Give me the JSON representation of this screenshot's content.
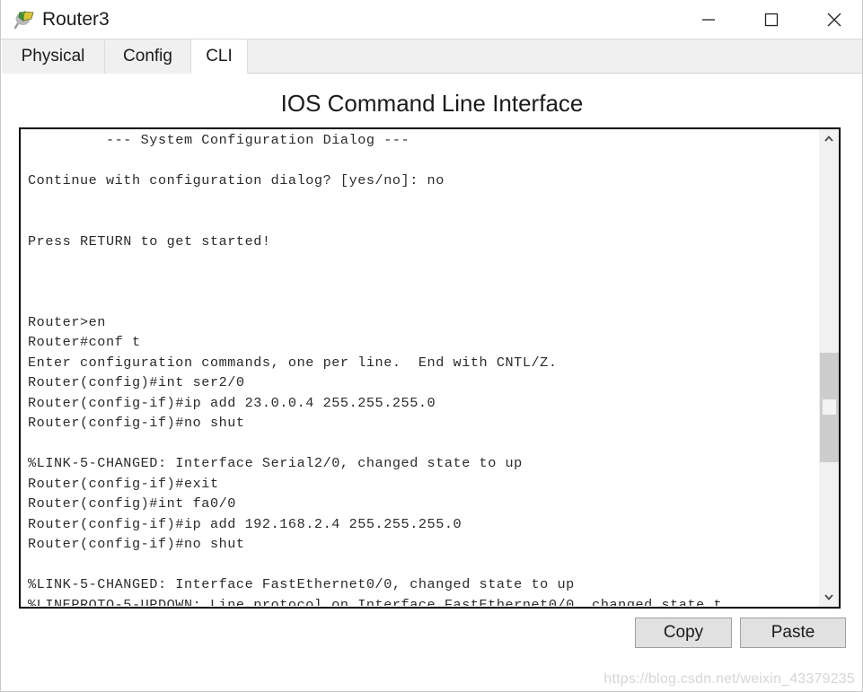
{
  "window": {
    "title": "Router3",
    "icon": "router-device-icon",
    "controls": {
      "minimize_label": "—",
      "maximize_label": "□",
      "close_label": "✕"
    }
  },
  "tabs": [
    {
      "label": "Physical",
      "active": false
    },
    {
      "label": "Config",
      "active": false
    },
    {
      "label": "CLI",
      "active": true
    }
  ],
  "main": {
    "heading": "IOS Command Line Interface"
  },
  "terminal": {
    "text": "         --- System Configuration Dialog ---\n\nContinue with configuration dialog? [yes/no]: no\n\n\nPress RETURN to get started!\n\n\n\nRouter>en\nRouter#conf t\nEnter configuration commands, one per line.  End with CNTL/Z.\nRouter(config)#int ser2/0\nRouter(config-if)#ip add 23.0.0.4 255.255.255.0\nRouter(config-if)#no shut\n\n%LINK-5-CHANGED: Interface Serial2/0, changed state to up\nRouter(config-if)#exit\nRouter(config)#int fa0/0\nRouter(config-if)#ip add 192.168.2.4 255.255.255.0\nRouter(config-if)#no shut\n\n%LINK-5-CHANGED: Interface FastEthernet0/0, changed state to up\n%LINEPROTO-5-UPDOWN: Line protocol on Interface FastEthernet0/0, changed state t",
    "lines": [
      "         --- System Configuration Dialog ---",
      "",
      "Continue with configuration dialog? [yes/no]: no",
      "",
      "",
      "Press RETURN to get started!",
      "",
      "",
      "",
      "Router>en",
      "Router#conf t",
      "Enter configuration commands, one per line.  End with CNTL/Z.",
      "Router(config)#int ser2/0",
      "Router(config-if)#ip add 23.0.0.4 255.255.255.0",
      "Router(config-if)#no shut",
      "",
      "%LINK-5-CHANGED: Interface Serial2/0, changed state to up",
      "Router(config-if)#exit",
      "Router(config)#int fa0/0",
      "Router(config-if)#ip add 192.168.2.4 255.255.255.0",
      "Router(config-if)#no shut",
      "",
      "%LINK-5-CHANGED: Interface FastEthernet0/0, changed state to up",
      "%LINEPROTO-5-UPDOWN: Line protocol on Interface FastEthernet0/0, changed state t"
    ]
  },
  "scrollbar": {
    "up_arrow": "chevron-up-icon",
    "down_arrow": "chevron-down-icon"
  },
  "buttons": {
    "copy_label": "Copy",
    "paste_label": "Paste"
  },
  "watermark": {
    "text": "https://blog.csdn.net/weixin_43379235"
  },
  "colors": {
    "window_bg": "#ffffff",
    "tabstrip_bg": "#f0f0f0",
    "active_tab_bg": "#ffffff",
    "terminal_border": "#000000",
    "terminal_text": "#2a2a2a",
    "button_bg": "#e1e1e1",
    "button_border": "#a0a0a0",
    "scrollbar_track": "#f1f1f1",
    "scrollbar_thumb": "#cdcdcd",
    "watermark": "#d6d6d6"
  }
}
